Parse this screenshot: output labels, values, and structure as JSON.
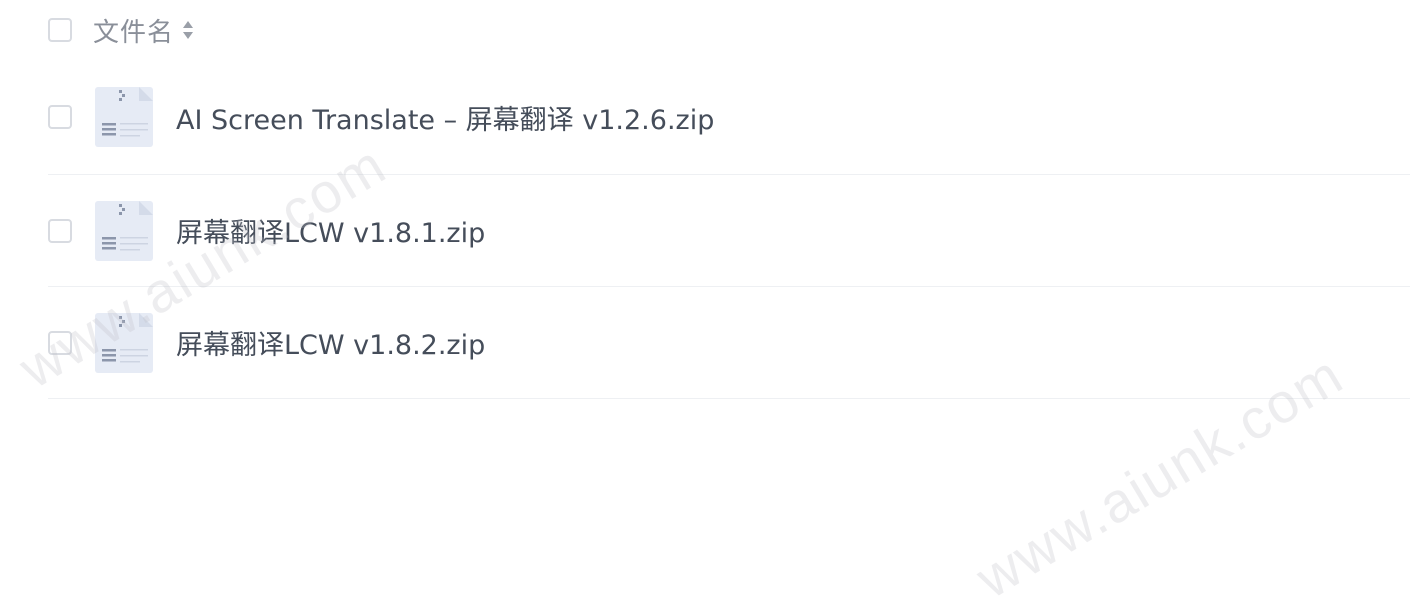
{
  "header": {
    "column_label": "文件名",
    "sort_icon": "sort-updown-icon"
  },
  "files": [
    {
      "name": "AI Screen Translate – 屏幕翻译 v1.2.6.zip",
      "icon": "zip-file-icon"
    },
    {
      "name": "屏幕翻译LCW v1.8.1.zip",
      "icon": "zip-file-icon"
    },
    {
      "name": "屏幕翻译LCW v1.8.2.zip",
      "icon": "zip-file-icon"
    }
  ],
  "watermark": "www.aiunk.com",
  "colors": {
    "text": "#454d5a",
    "header_text": "#8a8f99",
    "checkbox_border": "#d8dbe1",
    "row_divider": "#eef0f3",
    "icon_body": "#e6ebf5"
  }
}
